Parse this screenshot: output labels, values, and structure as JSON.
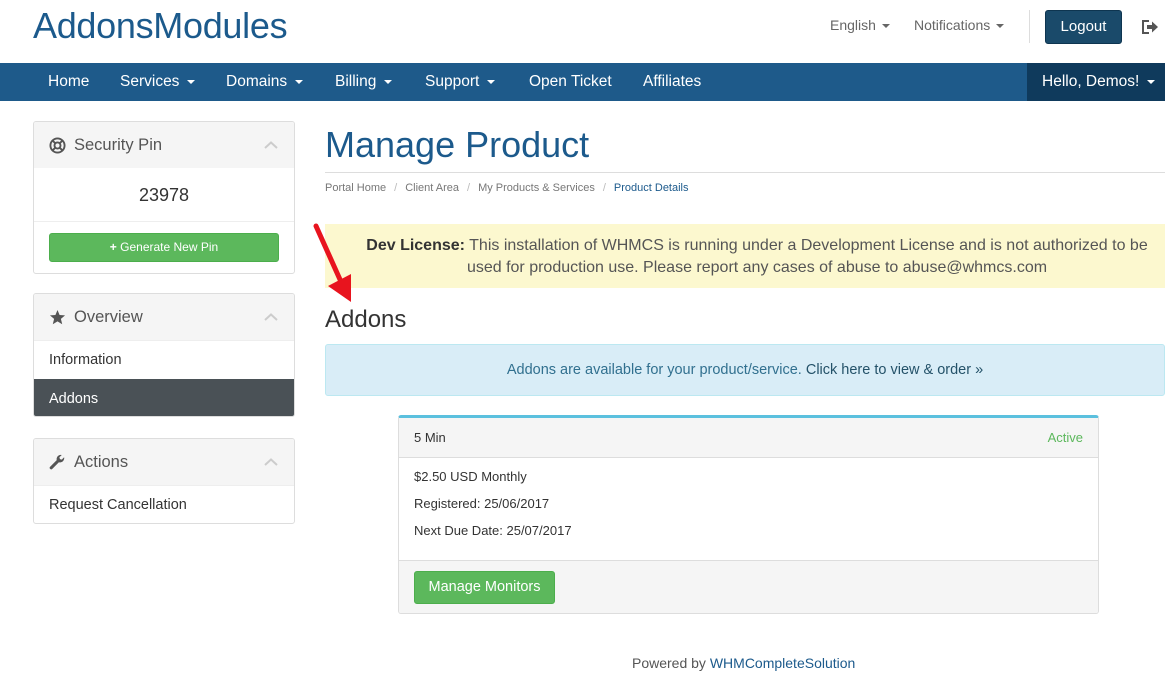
{
  "header": {
    "logo": "AddonsModules",
    "language": "English",
    "notifications": "Notifications",
    "logout": "Logout"
  },
  "nav": {
    "items": [
      {
        "label": "Home",
        "dropdown": false
      },
      {
        "label": "Services",
        "dropdown": true
      },
      {
        "label": "Domains",
        "dropdown": true
      },
      {
        "label": "Billing",
        "dropdown": true
      },
      {
        "label": "Support",
        "dropdown": true
      },
      {
        "label": "Open Ticket",
        "dropdown": false
      },
      {
        "label": "Affiliates",
        "dropdown": false
      }
    ],
    "user": "Hello, Demos!"
  },
  "sidebar": {
    "security": {
      "title": "Security Pin",
      "pin": "23978",
      "button": "Generate New Pin"
    },
    "overview": {
      "title": "Overview",
      "items": [
        "Information",
        "Addons"
      ],
      "active": "Addons"
    },
    "actions": {
      "title": "Actions",
      "items": [
        "Request Cancellation"
      ]
    }
  },
  "main": {
    "title": "Manage Product",
    "breadcrumb": [
      "Portal Home",
      "Client Area",
      "My Products & Services",
      "Product Details"
    ],
    "dev_alert": {
      "bold": "Dev License:",
      "text": " This installation of WHMCS is running under a Development License and is not authorized to be used for production use. Please report any cases of abuse to abuse@whmcs.com"
    },
    "section_title": "Addons",
    "info_alert": {
      "text": "Addons are available for your product/service. ",
      "link": "Click here to view & order »"
    },
    "addon": {
      "name": "5 Min",
      "status": "Active",
      "price": "$2.50 USD Monthly",
      "registered": "Registered: 25/06/2017",
      "next_due": "Next Due Date: 25/07/2017",
      "button": "Manage Monitors"
    }
  },
  "footer": {
    "text": "Powered by ",
    "link": "WHMCompleteSolution"
  },
  "colors": {
    "brand": "#1c5a8c",
    "nav_bg": "#1e5a8a",
    "success": "#5cb85c",
    "info_bg": "#d9edf7",
    "warning_bg": "#fcf8cf"
  }
}
